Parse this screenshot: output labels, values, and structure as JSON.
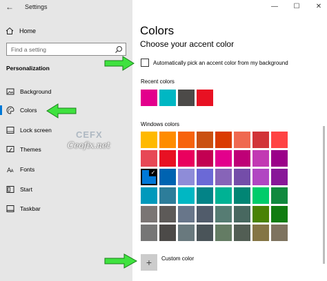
{
  "window": {
    "title": "Settings",
    "controls": [
      "—",
      "☐",
      "✕"
    ]
  },
  "sidebar": {
    "home_label": "Home",
    "search_placeholder": "Find a setting",
    "section_title": "Personalization",
    "items": [
      {
        "label": "Background",
        "icon": "image-icon"
      },
      {
        "label": "Colors",
        "icon": "palette-icon",
        "active": true
      },
      {
        "label": "Lock screen",
        "icon": "lock-screen-icon"
      },
      {
        "label": "Themes",
        "icon": "brush-icon"
      },
      {
        "label": "Fonts",
        "icon": "font-icon"
      },
      {
        "label": "Start",
        "icon": "start-icon"
      },
      {
        "label": "Taskbar",
        "icon": "taskbar-icon"
      }
    ]
  },
  "main": {
    "title": "Colors",
    "subtitle": "Choose your accent color",
    "auto_pick_label": "Automatically pick an accent color from my background",
    "auto_pick_checked": false,
    "recent_label": "Recent colors",
    "recent_colors": [
      "#e3008c",
      "#00b7c3",
      "#4c4a48",
      "#e81123"
    ],
    "windows_colors_label": "Windows colors",
    "windows_colors": [
      [
        "#ffb900",
        "#ff8c00",
        "#f7630c",
        "#ca5010",
        "#da3b01",
        "#ef6950",
        "#d13438",
        "#ff4343"
      ],
      [
        "#e74856",
        "#e81123",
        "#ea005e",
        "#c30052",
        "#e3008c",
        "#bf0077",
        "#c239b3",
        "#9a0089"
      ],
      [
        "#0078d7",
        "#0063b1",
        "#8e8cd8",
        "#6b69d6",
        "#8764b8",
        "#744da9",
        "#b146c2",
        "#881798"
      ],
      [
        "#0099bc",
        "#2d7d9a",
        "#00b7c3",
        "#038387",
        "#00b294",
        "#018574",
        "#00cc6a",
        "#10893e"
      ],
      [
        "#7a7574",
        "#5d5a58",
        "#68768a",
        "#515c6b",
        "#567c73",
        "#486860",
        "#498205",
        "#107c10"
      ],
      [
        "#767676",
        "#4c4a48",
        "#69797e",
        "#4a5459",
        "#647c64",
        "#525e54",
        "#847545",
        "#7e735f"
      ]
    ],
    "selected_color": "#0078d7",
    "custom_color_label": "Custom color"
  },
  "watermark": {
    "line1": "CEFX",
    "line2": "Ceofix.net"
  }
}
